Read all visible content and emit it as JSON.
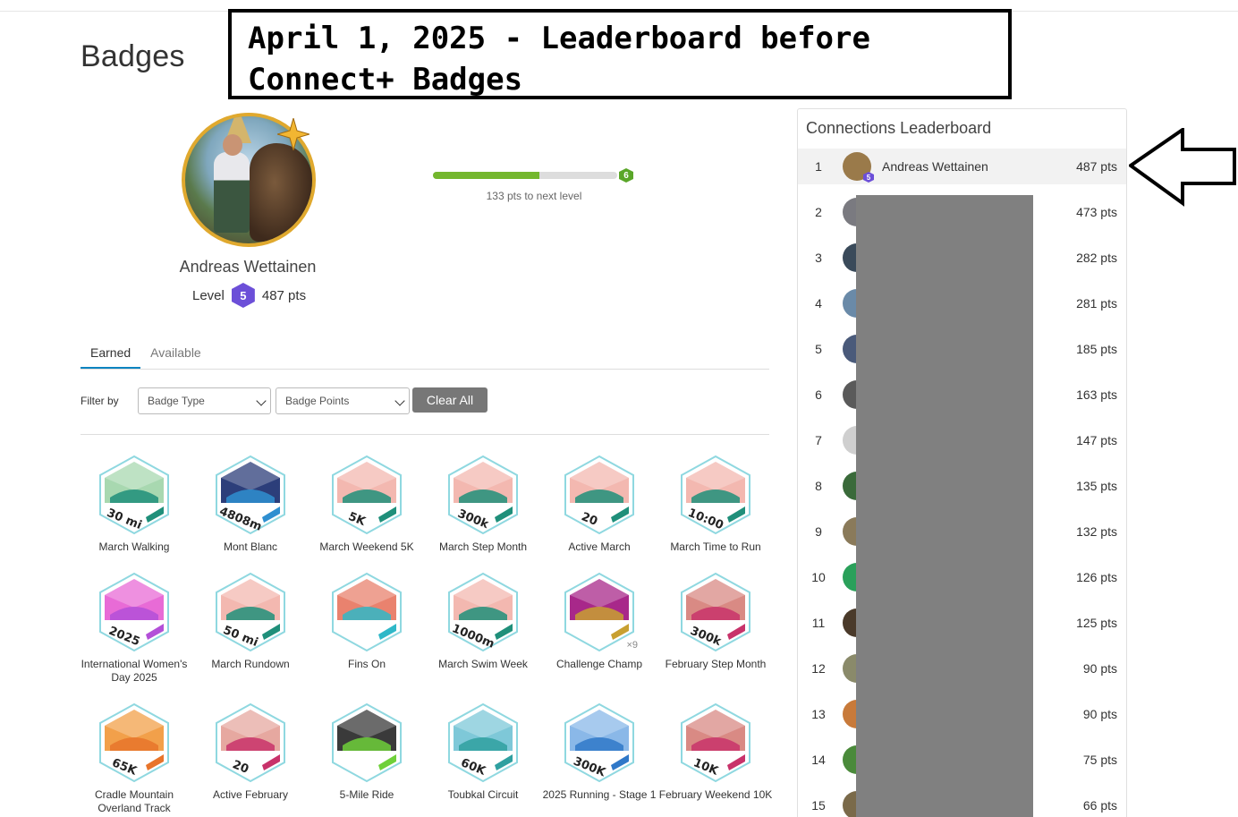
{
  "page": {
    "title": "Badges"
  },
  "annotation": {
    "line1": "April 1, 2025 - Leaderboard before",
    "line2": "Connect+ Badges"
  },
  "profile": {
    "name": "Andreas Wettainen",
    "level_label": "Level",
    "level": "5",
    "points": "487 pts",
    "next_level": "6",
    "progress_fraction": 0.58,
    "progress_text": "133 pts to next level"
  },
  "tabs": [
    {
      "label": "Earned",
      "active": true
    },
    {
      "label": "Available",
      "active": false
    }
  ],
  "filter": {
    "label": "Filter by",
    "badge_type": "Badge Type",
    "badge_points": "Badge Points",
    "clear_label": "Clear All"
  },
  "badges": [
    {
      "label": "March Walking",
      "text": "30 mi",
      "top_color": "#a8d8b0",
      "accent": "#1f8f7a",
      "icon": "walking-path-icon"
    },
    {
      "label": "Mont Blanc",
      "text": "4808m",
      "top_color": "#2c3e7a",
      "accent": "#2f8fd0",
      "icon": "mountain-icon"
    },
    {
      "label": "March Weekend 5K",
      "text": "5K",
      "top_color": "#f3b8b0",
      "accent": "#1f8f7a",
      "icon": "shoe-icon"
    },
    {
      "label": "March Step Month",
      "text": "300k",
      "top_color": "#f3b8b0",
      "accent": "#1f8f7a",
      "icon": "wing-shoe-icon"
    },
    {
      "label": "Active March",
      "text": "20",
      "top_color": "#f3b8b0",
      "accent": "#1f8f7a",
      "icon": "stopwatch-icon"
    },
    {
      "label": "March Time to Run",
      "text": "10:00",
      "top_color": "#f3b8b0",
      "accent": "#1f8f7a",
      "icon": "shoe-icon"
    },
    {
      "label": "International Women's Day 2025",
      "text": "2025",
      "top_color": "#e86bd6",
      "accent": "#b34fd8",
      "icon": "heart-icon"
    },
    {
      "label": "March Rundown",
      "text": "50 mi",
      "top_color": "#f3b8b0",
      "accent": "#1f8f7a",
      "icon": "wing-shoe-icon"
    },
    {
      "label": "Fins On",
      "text": "",
      "top_color": "#e9826e",
      "accent": "#2fb8c8",
      "icon": "swimmer-icon"
    },
    {
      "label": "March Swim Week",
      "text": "1000m",
      "top_color": "#f3b8b0",
      "accent": "#1f8f7a",
      "icon": "swimmer-icon"
    },
    {
      "label": "Challenge Champ",
      "text": "",
      "top_color": "#a8288a",
      "accent": "#c8a030",
      "icon": "podium-icon",
      "multiplier": "×9"
    },
    {
      "label": "February Step Month",
      "text": "300k",
      "top_color": "#d98a84",
      "accent": "#c8326a",
      "icon": "wing-shoe-icon"
    },
    {
      "label": "Cradle Mountain Overland Track",
      "text": "65K",
      "top_color": "#f2a04a",
      "accent": "#e8742a",
      "icon": "mountain-icon"
    },
    {
      "label": "Active February",
      "text": "20",
      "top_color": "#e6a8a0",
      "accent": "#c8326a",
      "icon": "stopwatch-icon"
    },
    {
      "label": "5-Mile Ride",
      "text": "",
      "top_color": "#3a3a3a",
      "accent": "#6fd03a",
      "icon": "bike-icon"
    },
    {
      "label": "Toubkal Circuit",
      "text": "60K",
      "top_color": "#7ec8d8",
      "accent": "#2fa0a0",
      "icon": "mountain-icon"
    },
    {
      "label": "2025 Running - Stage 1",
      "text": "300K",
      "top_color": "#8ab8e8",
      "accent": "#2f78c8",
      "icon": "wing-shoe-icon"
    },
    {
      "label": "February Weekend 10K",
      "text": "10K",
      "top_color": "#d98a84",
      "accent": "#c8326a",
      "icon": "shoe-icon"
    }
  ],
  "leaderboard": {
    "title": "Connections Leaderboard",
    "rows": [
      {
        "rank": "1",
        "name": "Andreas Wettainen",
        "pts": "487 pts",
        "me": true,
        "level": "5",
        "avatar_color": "#9a7a4a"
      },
      {
        "rank": "2",
        "name": "",
        "pts": "473 pts",
        "avatar_color": "#7a7a80"
      },
      {
        "rank": "3",
        "name": "",
        "pts": "282 pts",
        "avatar_color": "#3a4a5a"
      },
      {
        "rank": "4",
        "name": "",
        "pts": "281 pts",
        "avatar_color": "#6a8aa8"
      },
      {
        "rank": "5",
        "name": "",
        "pts": "185 pts",
        "avatar_color": "#4a5a7a"
      },
      {
        "rank": "6",
        "name": "",
        "pts": "163 pts",
        "avatar_color": "#5a5a5a"
      },
      {
        "rank": "7",
        "name": "",
        "pts": "147 pts",
        "avatar_color": "#cfcfcf"
      },
      {
        "rank": "8",
        "name": "",
        "pts": "135 pts",
        "avatar_color": "#3a6a3a"
      },
      {
        "rank": "9",
        "name": "",
        "pts": "132 pts",
        "avatar_color": "#8a7a5a"
      },
      {
        "rank": "10",
        "name": "",
        "pts": "126 pts",
        "avatar_color": "#2aa05a"
      },
      {
        "rank": "11",
        "name": "",
        "pts": "125 pts",
        "avatar_color": "#4a3a2a"
      },
      {
        "rank": "12",
        "name": "",
        "pts": "90 pts",
        "avatar_color": "#8a8a6a"
      },
      {
        "rank": "13",
        "name": "",
        "pts": "90 pts",
        "avatar_color": "#c87a3a"
      },
      {
        "rank": "14",
        "name": "",
        "pts": "75 pts",
        "avatar_color": "#4a8a3a"
      },
      {
        "rank": "15",
        "name": "",
        "pts": "66 pts",
        "avatar_color": "#7a6a4a"
      }
    ]
  }
}
